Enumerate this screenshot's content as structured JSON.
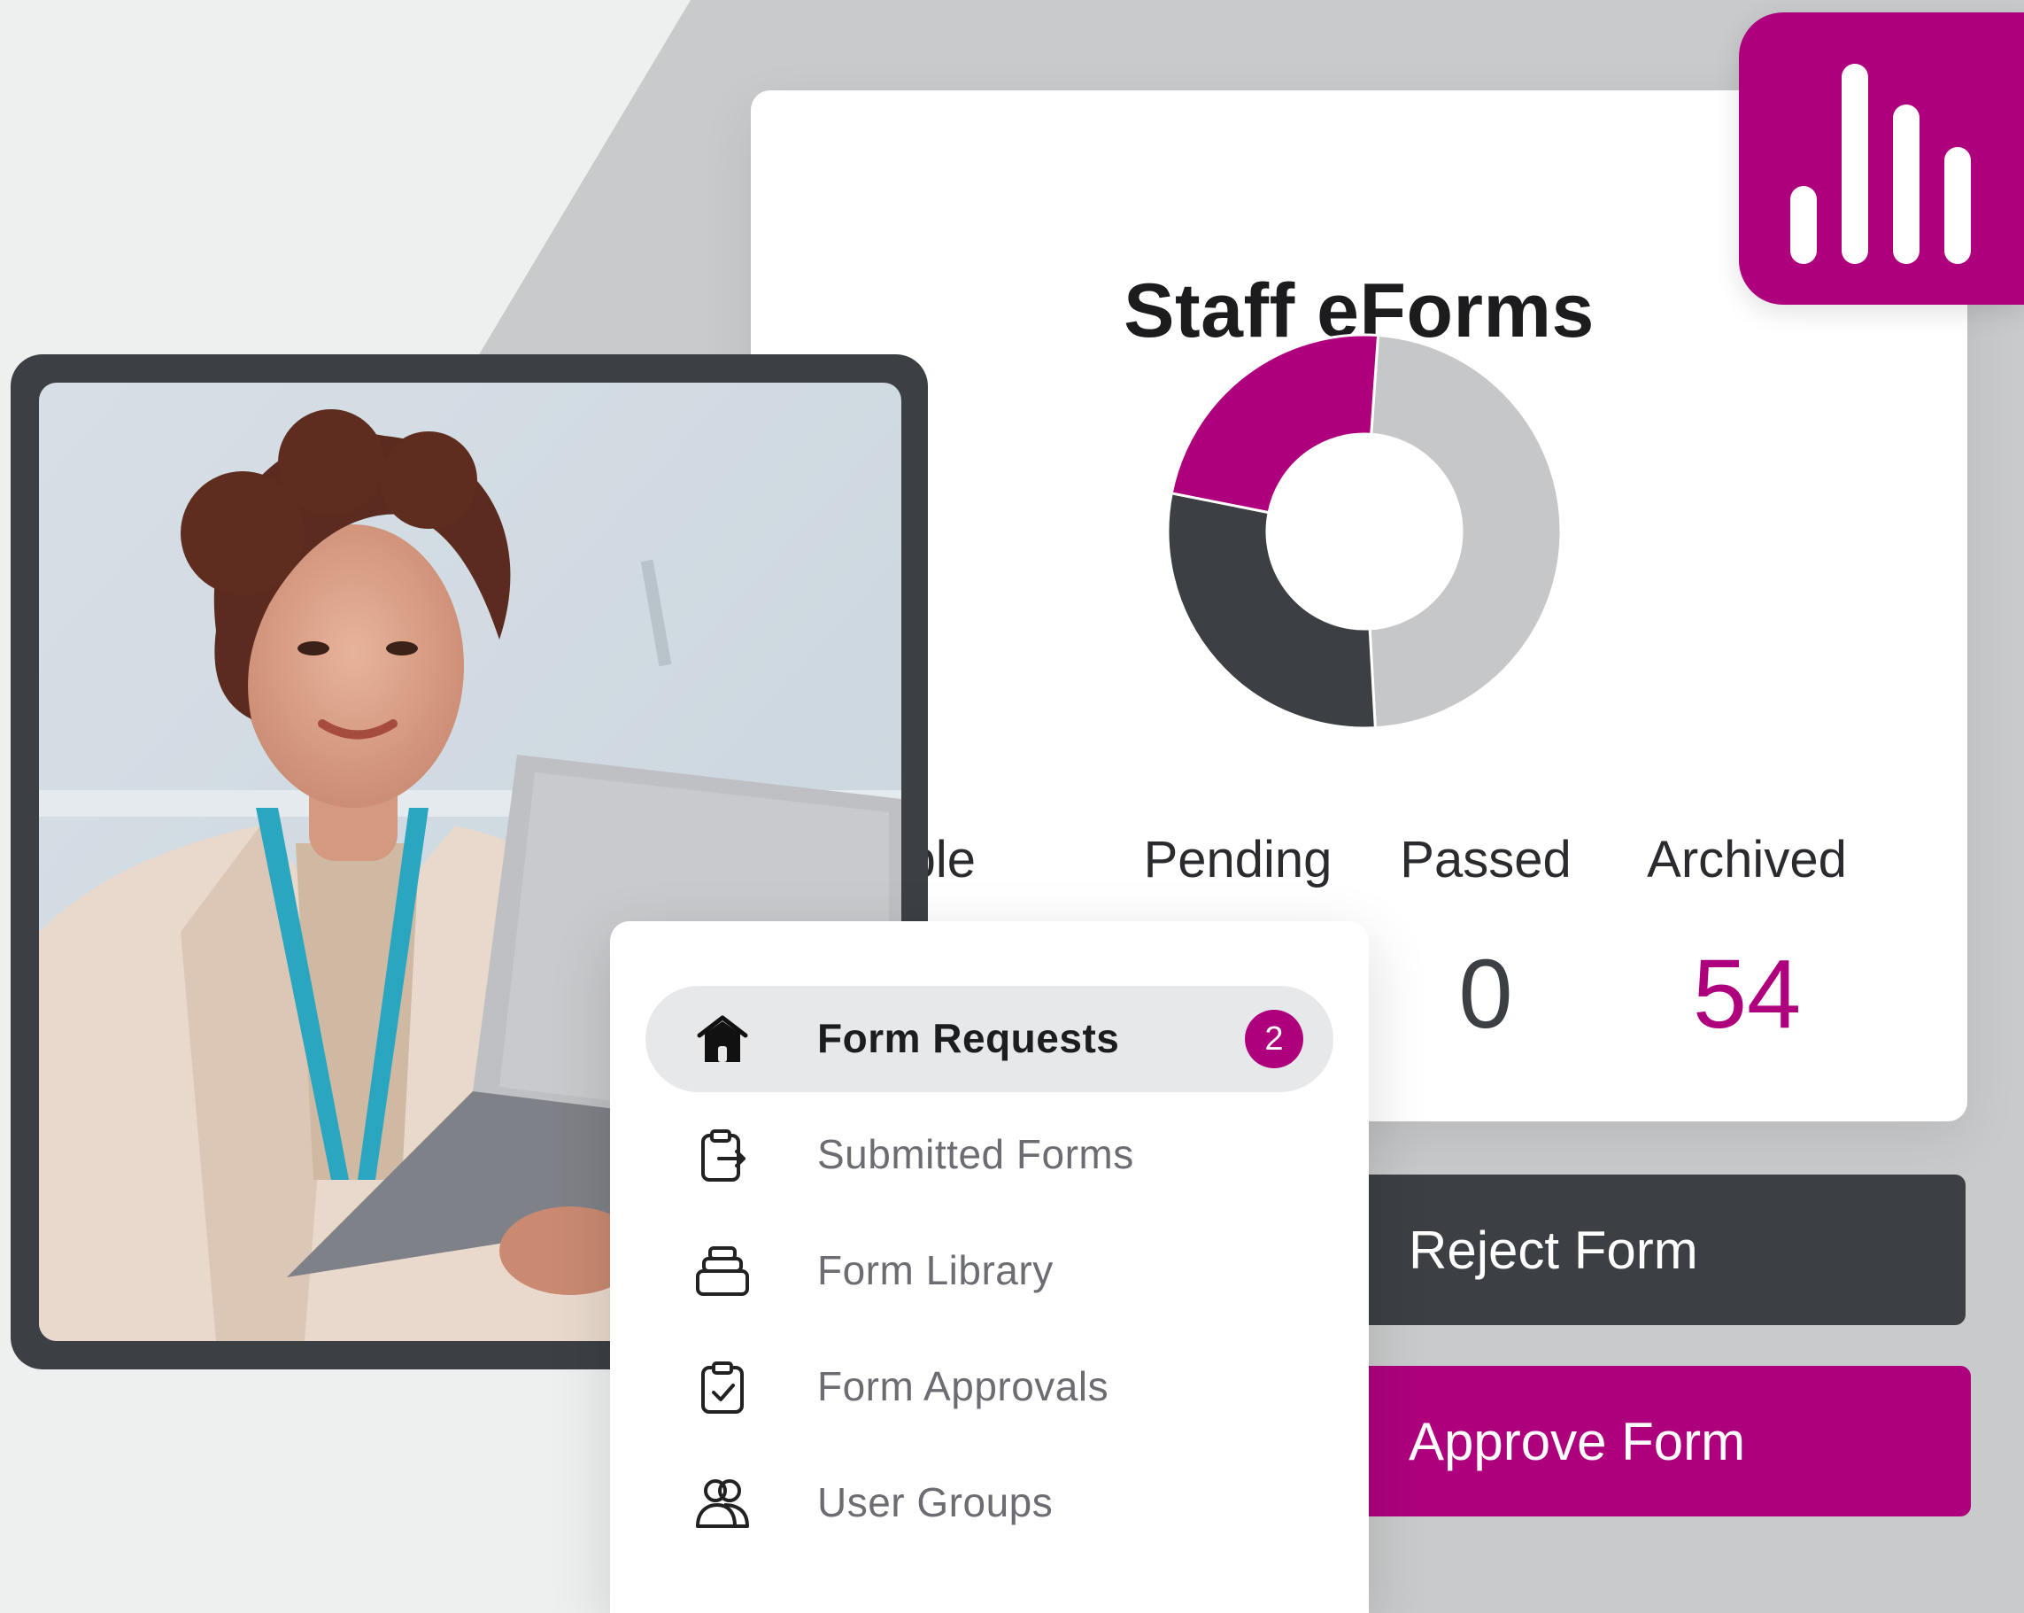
{
  "stats_card": {
    "title": "Staff eForms",
    "columns": [
      {
        "label": "Available",
        "label_visible": "ailable",
        "value": ""
      },
      {
        "label": "Pending",
        "value": ""
      },
      {
        "label": "Passed",
        "value": "0"
      },
      {
        "label": "Archived",
        "value": "54"
      }
    ]
  },
  "chart_data": {
    "type": "pie",
    "donut": true,
    "slices": [
      {
        "value": 0.48,
        "color": "#c6c7c8"
      },
      {
        "value": 0.29,
        "color": "#3c3f44"
      },
      {
        "value": 0.23,
        "color": "#ae007d"
      }
    ]
  },
  "actions": {
    "reject_label": "Reject Form",
    "approve_label": "Approve Form"
  },
  "menu": {
    "items": [
      {
        "label": "Form Requests",
        "icon": "home-icon",
        "badge": "2",
        "active": true
      },
      {
        "label": "Submitted Forms",
        "icon": "clipboard-export-icon"
      },
      {
        "label": "Form Library",
        "icon": "stack-icon"
      },
      {
        "label": "Form Approvals",
        "icon": "clipboard-check-icon"
      },
      {
        "label": "User Groups",
        "icon": "users-icon"
      }
    ]
  },
  "logo": {
    "icon": "bar-chart-icon"
  },
  "colors": {
    "brand": "#ae007d",
    "dark": "#3c3f44",
    "light_gray": "#c6c7c8",
    "background": "#eef0f0"
  }
}
